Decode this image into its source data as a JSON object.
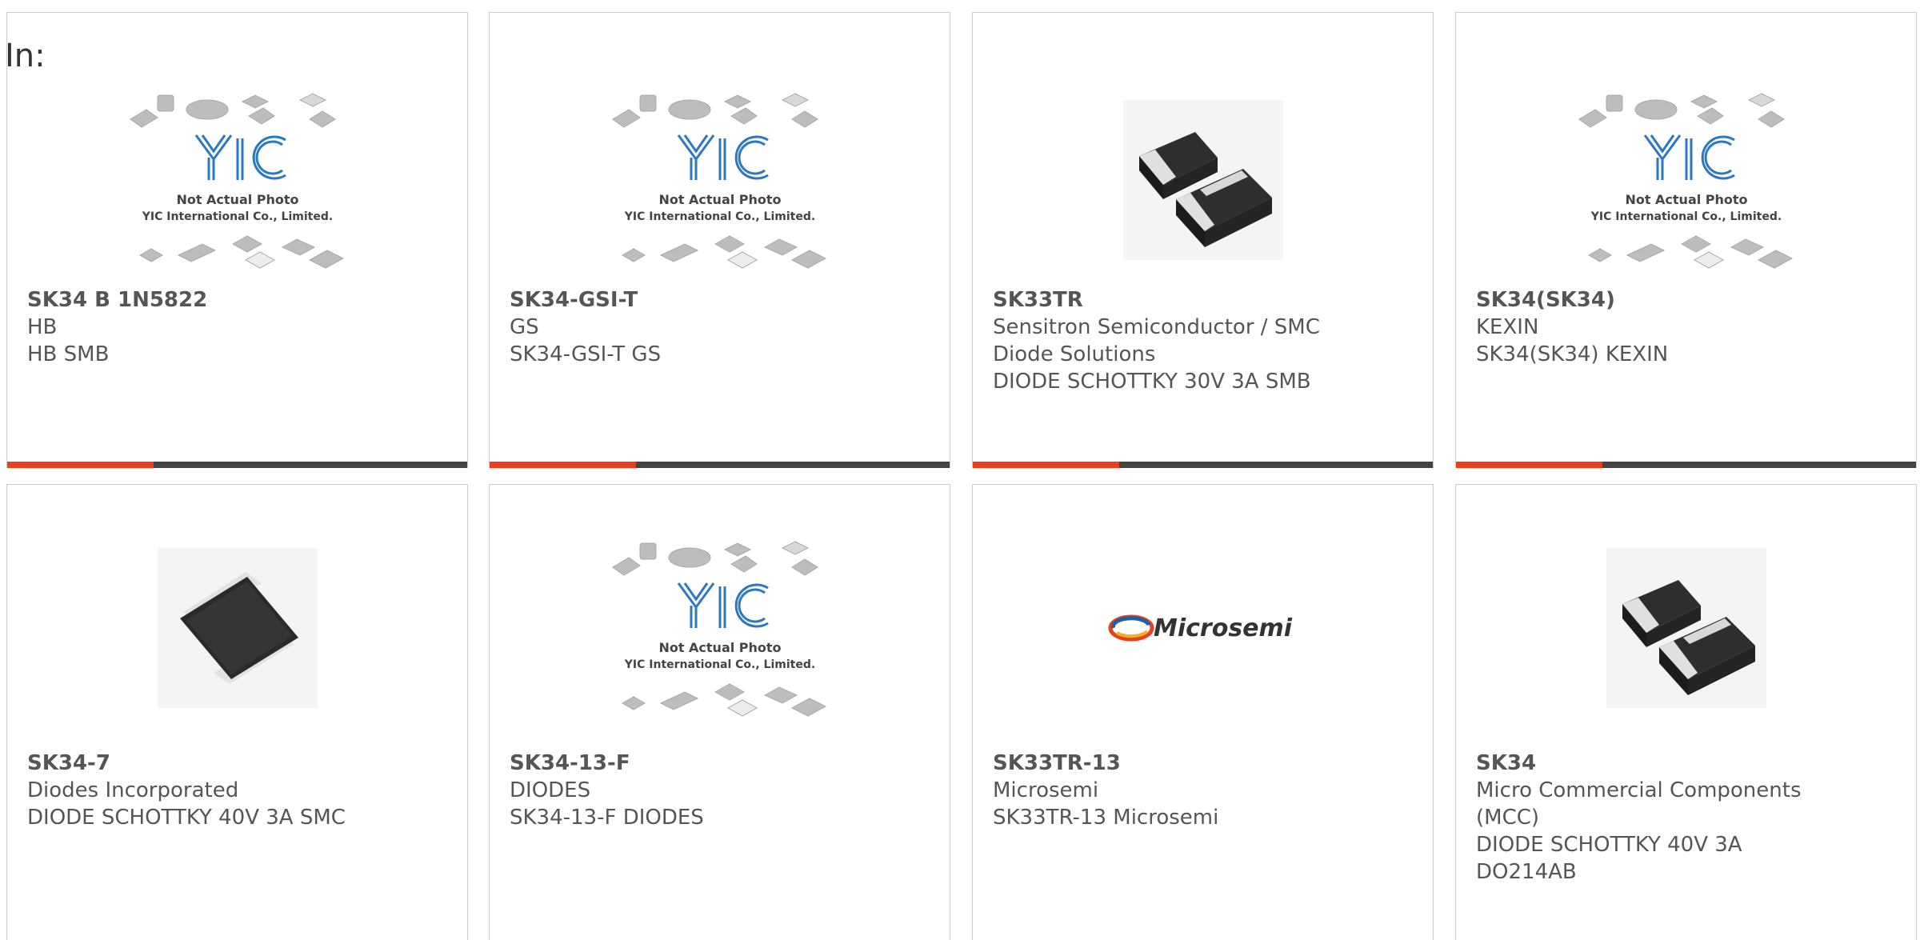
{
  "header": {
    "label": "In:"
  },
  "colors": {
    "accent": "#e8401c",
    "bar": "#444444",
    "border": "#cccccc",
    "text": "#555555"
  },
  "placeholder": {
    "line1": "Not Actual Photo",
    "line2": "YIC International Co., Limited.",
    "logo": "YIC"
  },
  "brand_logo": {
    "text": "Microsemi"
  },
  "cards": [
    {
      "title": "SK34 B 1N5822",
      "lines": [
        "HB",
        "HB SMB"
      ],
      "image": "yic-placeholder-icon"
    },
    {
      "title": "SK34-GSI-T",
      "lines": [
        "GS",
        "SK34-GSI-T GS"
      ],
      "image": "yic-placeholder-icon"
    },
    {
      "title": "SK33TR",
      "lines": [
        "Sensitron Semiconductor / SMC",
        "Diode Solutions",
        "DIODE SCHOTTKY 30V 3A SMB"
      ],
      "image": "smd-diode-pair-icon"
    },
    {
      "title": "SK34(SK34)",
      "lines": [
        "KEXIN",
        "SK34(SK34) KEXIN"
      ],
      "image": "yic-placeholder-icon"
    },
    {
      "title": "SK34-7",
      "lines": [
        "Diodes Incorporated",
        "DIODE SCHOTTKY 40V 3A SMC"
      ],
      "image": "smc-diode-icon"
    },
    {
      "title": "SK34-13-F",
      "lines": [
        "DIODES",
        "SK34-13-F DIODES"
      ],
      "image": "yic-placeholder-icon"
    },
    {
      "title": "SK33TR-13",
      "lines": [
        "Microsemi",
        "SK33TR-13 Microsemi"
      ],
      "image": "microsemi-logo"
    },
    {
      "title": "SK34",
      "lines": [
        "Micro Commercial Components",
        "(MCC)",
        "DIODE SCHOTTKY 40V 3A",
        "DO214AB"
      ],
      "image": "smd-diode-pair-icon"
    }
  ]
}
